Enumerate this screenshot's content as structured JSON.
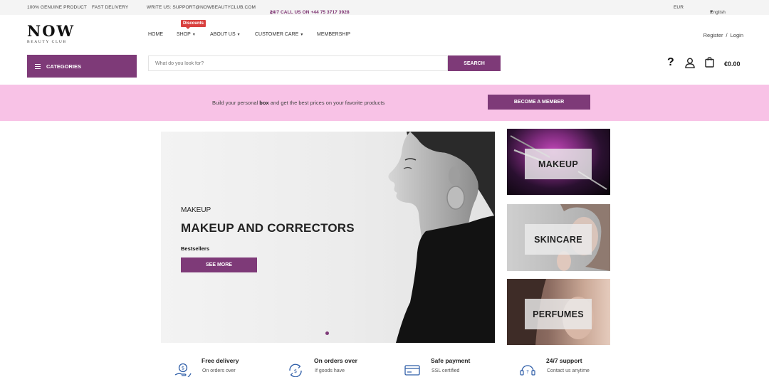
{
  "topbar": {
    "genuine": "100% GENUINE PRODUCT",
    "delivery": "FAST DELIVERY",
    "write_us": "WRITE US: SUPPORT@NOWBEAUTYCLUB.COM",
    "call_us": "24/7 CALL US ON +44 75 3717 3928",
    "currency": "EUR",
    "language": "English"
  },
  "logo": {
    "name": "NOW",
    "tagline": "BEAUTY CLUB"
  },
  "nav": {
    "badge": "Discounts",
    "items": [
      {
        "label": "HOME",
        "dropdown": false
      },
      {
        "label": "SHOP",
        "dropdown": true
      },
      {
        "label": "ABOUT US",
        "dropdown": true
      },
      {
        "label": "CUSTOMER CARE",
        "dropdown": true
      },
      {
        "label": "MEMBERSHIP",
        "dropdown": false
      }
    ]
  },
  "auth": {
    "register": "Register",
    "separator": "/",
    "login": "Login"
  },
  "categories_label": "CATEGORIES",
  "search": {
    "placeholder": "What do you look for?",
    "button": "SEARCH"
  },
  "cart": {
    "total": "€0.00"
  },
  "icons": {
    "help": "question-mark-icon",
    "account": "user-icon",
    "cart": "shopping-bag-icon",
    "menu": "hamburger-icon"
  },
  "band": {
    "text_before": "Build your personal ",
    "text_bold": "box",
    "text_after": " and get the best prices on your favorite products",
    "button": "BECOME A MEMBER"
  },
  "hero": {
    "kicker": "MAKEUP",
    "title": "MAKEUP AND CORRECTORS",
    "subtitle": "Bestsellers",
    "button": "SEE MORE"
  },
  "tiles": [
    {
      "label": "MAKEUP"
    },
    {
      "label": "SKINCARE"
    },
    {
      "label": "PERFUMES"
    }
  ],
  "features": [
    {
      "title": "Free delivery",
      "subtitle": "On orders over",
      "icon": "hand-coin-icon"
    },
    {
      "title": "On orders over",
      "subtitle": "If goods have",
      "icon": "refund-icon"
    },
    {
      "title": "Safe payment",
      "subtitle": "SSL certified",
      "icon": "credit-card-icon"
    },
    {
      "title": "24/7 support",
      "subtitle": "Contact us anytime",
      "icon": "headset-icon"
    }
  ],
  "colors": {
    "brand": "#7e3a78",
    "band": "#f8c2e6",
    "badge": "#d9413f"
  }
}
